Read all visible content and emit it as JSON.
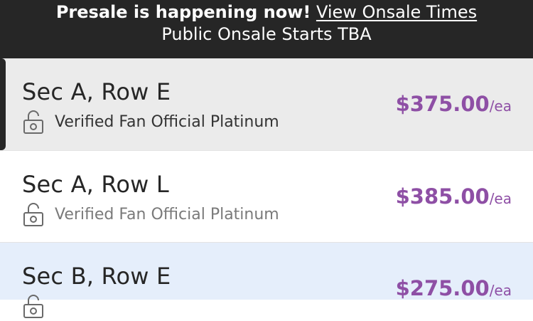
{
  "banner": {
    "headline": "Presale is happening now!",
    "link": "View Onsale Times",
    "subline": "Public Onsale Starts TBA"
  },
  "listings": [
    {
      "section_row": "Sec A, Row E",
      "tier": "Verified Fan Official Platinum",
      "price": "$375.00",
      "unit": "/ea",
      "selected": true
    },
    {
      "section_row": "Sec A, Row L",
      "tier": "Verified Fan Official Platinum",
      "price": "$385.00",
      "unit": "/ea",
      "selected": false
    },
    {
      "section_row": "Sec B, Row E",
      "tier": "",
      "price": "$275.00",
      "unit": "/ea",
      "selected": false
    }
  ],
  "colors": {
    "banner_bg": "#262626",
    "selected_bg": "#ebebeb",
    "highlight_bg": "#e5eefb",
    "price": "#8e4fa5",
    "tier_text_selected": "#333333",
    "tier_text": "#7a7a7a"
  },
  "icons": {
    "tier": "lock-icon"
  }
}
